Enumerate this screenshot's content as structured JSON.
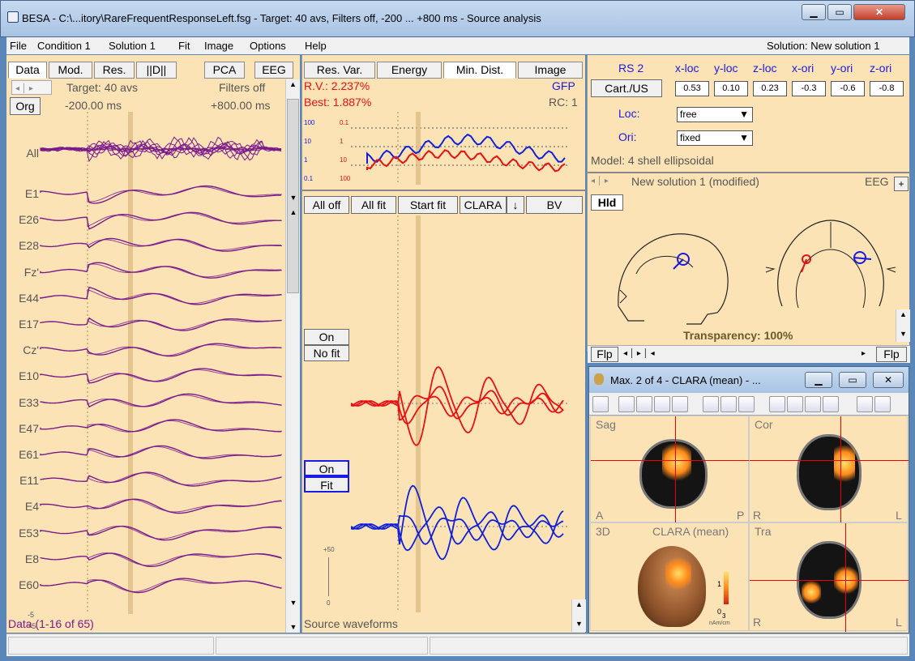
{
  "window": {
    "title": "BESA - C:\\...itory\\RareFrequentResponseLeft.fsg - Target: 40 avs, Filters off, -200 ... +800 ms - Source analysis"
  },
  "menu": {
    "items": [
      "File",
      "Condition 1",
      "Solution 1",
      "Fit",
      "Image",
      "Options",
      "Help"
    ],
    "solution_label": "Solution: New solution 1"
  },
  "left": {
    "tabs": [
      "Data",
      "Mod.",
      "Res.",
      "||D||",
      "PCA",
      "EEG"
    ],
    "target": "Target: 40 avs",
    "filters": "Filters off",
    "org": "Org",
    "start_ms": "-200.00 ms",
    "end_ms": "+800.00 ms",
    "channels": [
      "All",
      "E1",
      "E26",
      "E28",
      "Fz'",
      "E44",
      "E17",
      "Cz'",
      "E10",
      "E33",
      "E47",
      "E61",
      "E11",
      "E4",
      "E53",
      "E8",
      "E60"
    ],
    "scale_top": "-5",
    "scale_bottom": "+5",
    "footer": "Data (1-16 of 65)"
  },
  "middle": {
    "tabs": [
      "Res. Var.",
      "Energy",
      "Min. Dist.",
      "Image"
    ],
    "rv": "R.V.: 2.237%",
    "best": "Best: 1.887%",
    "gfp": "GFP",
    "rc": "RC: 1",
    "axis_left": [
      "100",
      "10",
      "1",
      "0.1"
    ],
    "axis_right": [
      "0.1",
      "1",
      "10",
      "100"
    ],
    "buttons": [
      "All off",
      "All fit",
      "Start fit",
      "CLARA",
      "BV"
    ],
    "source1": {
      "on": "On",
      "fit": "No fit"
    },
    "source2": {
      "on": "On",
      "fit": "Fit"
    },
    "scale_top": "+50",
    "scale_bottom": "0",
    "footer": "Source waveforms"
  },
  "right": {
    "source_name": "RS 2",
    "cart_btn": "Cart./US",
    "coord_headers": [
      "x-loc",
      "y-loc",
      "z-loc",
      "x-ori",
      "y-ori",
      "z-ori"
    ],
    "coord_values": [
      "0.53",
      "0.10",
      "0.23",
      "-0.3",
      "-0.6",
      "-0.8"
    ],
    "loc_label": "Loc:",
    "loc_value": "free",
    "ori_label": "Ori:",
    "ori_value": "fixed",
    "model": "Model: 4 shell ellipsoidal",
    "solution_title": "New solution 1 (modified)",
    "eeg": "EEG",
    "plus": "+",
    "hld": "Hld",
    "transparency": "Transparency: 100%",
    "flp": "Flp"
  },
  "mri_window": {
    "title": "Max. 2 of 4 - CLARA (mean) - ...",
    "panels": {
      "sag": "Sag",
      "cor": "Cor",
      "three_d": "3D",
      "tra": "Tra",
      "clara": "CLARA (mean)"
    },
    "orient": {
      "a": "A",
      "p": "P",
      "r": "R",
      "l": "L"
    },
    "colorbar_max": "1",
    "colorbar_min": "0",
    "colorbar_exp": "3",
    "colorbar_unit": "nAm/cm"
  },
  "colors": {
    "panel": "#fce3b6",
    "eeg": "#7a1a8a",
    "source1": "#e81010",
    "source2": "#1020d8",
    "accent": "#1a1ae0"
  }
}
